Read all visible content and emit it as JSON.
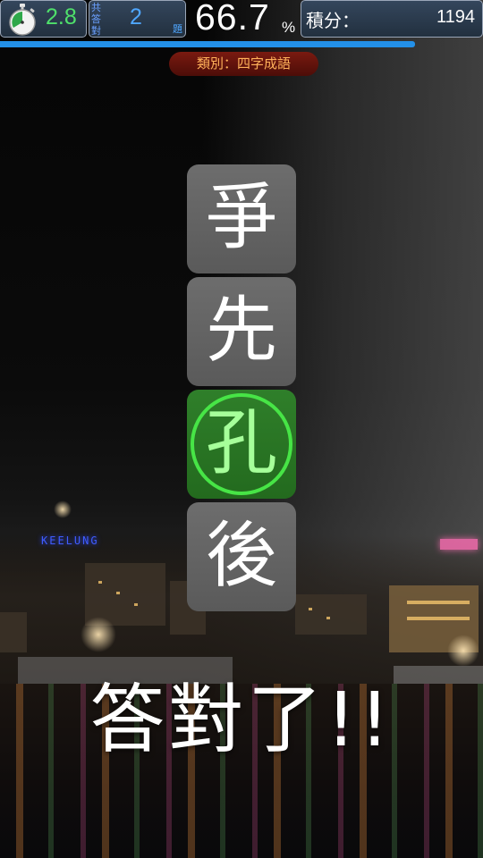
{
  "hud": {
    "timer_value": "2.8",
    "answered_label": "共答對",
    "answered_count": "2",
    "answered_unit": "題",
    "accuracy_value": "66.7",
    "accuracy_unit": "%",
    "score_label": "積分：",
    "score_value": "1194",
    "progress_fraction": 0.86
  },
  "category": "類別：四字成語",
  "idiom_tiles": [
    {
      "char": "爭",
      "state": "normal"
    },
    {
      "char": "先",
      "state": "normal"
    },
    {
      "char": "孔",
      "state": "selected"
    },
    {
      "char": "後",
      "state": "normal"
    }
  ],
  "result_text": "答對了!!",
  "background": {
    "sign_text": "KEELUNG"
  },
  "colors": {
    "timer": "#4fe06b",
    "count": "#4fa7ff",
    "progress": "#2390e8",
    "category_text": "#ffb15a",
    "selected_tile": "#2f7f2a",
    "selected_ring": "#47e546"
  },
  "icons": {
    "timer": "stopwatch-icon"
  }
}
